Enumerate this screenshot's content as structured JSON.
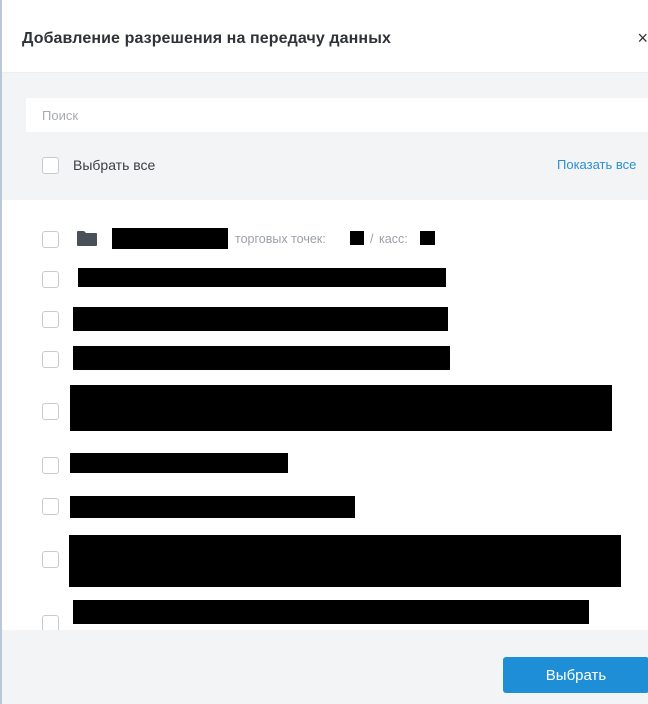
{
  "dialog": {
    "title": "Добавление разрешения на передачу данных",
    "close_glyph": "×"
  },
  "search": {
    "placeholder": "Поиск",
    "value": ""
  },
  "select_all": {
    "label": "Выбрать все",
    "checked": false
  },
  "show_all_link": "Показать все",
  "list": {
    "first_item": {
      "icon": "folder-icon",
      "name": "[redacted]",
      "stores_label": "торговых точек:",
      "stores_count": "[redacted]",
      "separator": "/",
      "registers_label": "касс:",
      "registers_count": "[redacted]"
    },
    "items": [
      {
        "name": "[redacted]",
        "checked": false
      },
      {
        "name": "[redacted]",
        "checked": false
      },
      {
        "name": "[redacted]",
        "checked": false
      },
      {
        "name": "[redacted]",
        "checked": false
      },
      {
        "name": "[redacted]",
        "checked": false
      },
      {
        "name": "[redacted]",
        "checked": false
      },
      {
        "name": "[redacted]",
        "checked": false
      },
      {
        "name": "[redacted]",
        "checked": false
      }
    ]
  },
  "footer": {
    "submit_label": "Выбрать"
  },
  "colors": {
    "accent": "#1e8fd6",
    "link": "#2a8fd0",
    "redaction": "#000000"
  }
}
